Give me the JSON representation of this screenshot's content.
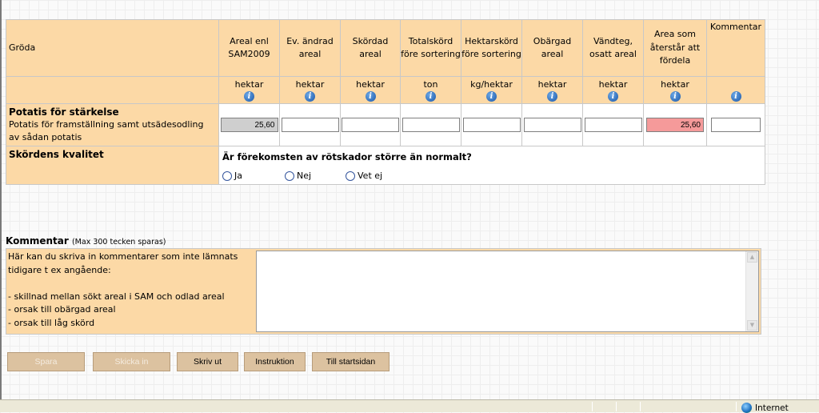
{
  "table": {
    "crop_header": "Gröda",
    "columns": [
      {
        "label": "Areal enl SAM2009",
        "unit": "hektar"
      },
      {
        "label": "Ev. ändrad areal",
        "unit": "hektar"
      },
      {
        "label": "Skördad areal",
        "unit": "hektar"
      },
      {
        "label": "Totalskörd före sortering",
        "unit": "ton"
      },
      {
        "label": "Hektarskörd före sortering",
        "unit": "kg/hektar"
      },
      {
        "label": "Obärgad areal",
        "unit": "hektar"
      },
      {
        "label": "Vändteg, osatt areal",
        "unit": "hektar"
      },
      {
        "label": "Area som återstår att fördela",
        "unit": "hektar"
      },
      {
        "label": "Kommentar",
        "unit": ""
      }
    ],
    "row": {
      "name": "Potatis för stärkelse",
      "description": "Potatis för framställning samt utsädesodling av sådan potatis",
      "values": [
        "25,60",
        "",
        "",
        "",
        "",
        "",
        "",
        "25,60",
        ""
      ]
    },
    "quality": {
      "label": "Skördens kvalitet",
      "question": "Är förekomsten av rötskador större än normalt?",
      "options": [
        "Ja",
        "Nej",
        "Vet ej"
      ]
    }
  },
  "comment": {
    "title": "Kommentar",
    "note": "(Max 300 tecken sparas)",
    "help_lines": [
      "Här kan du skriva in kommentarer som inte lämnats",
      "tidigare t ex angående:",
      "",
      "- skillnad mellan sökt areal i SAM och  odlad areal",
      "- orsak till obärgad areal",
      "- orsak till låg skörd"
    ],
    "value": ""
  },
  "buttons": {
    "save": "Spara",
    "send": "Skicka in",
    "print": "Skriv ut",
    "instructions": "Instruktion",
    "home": "Till startsidan"
  },
  "statusbar": {
    "zone": "Internet"
  },
  "colors": {
    "panel": "#fcd9a6",
    "alert_field": "#f59a9a",
    "readonly_field": "#cfcfcf",
    "button": "#dcc2a0"
  }
}
